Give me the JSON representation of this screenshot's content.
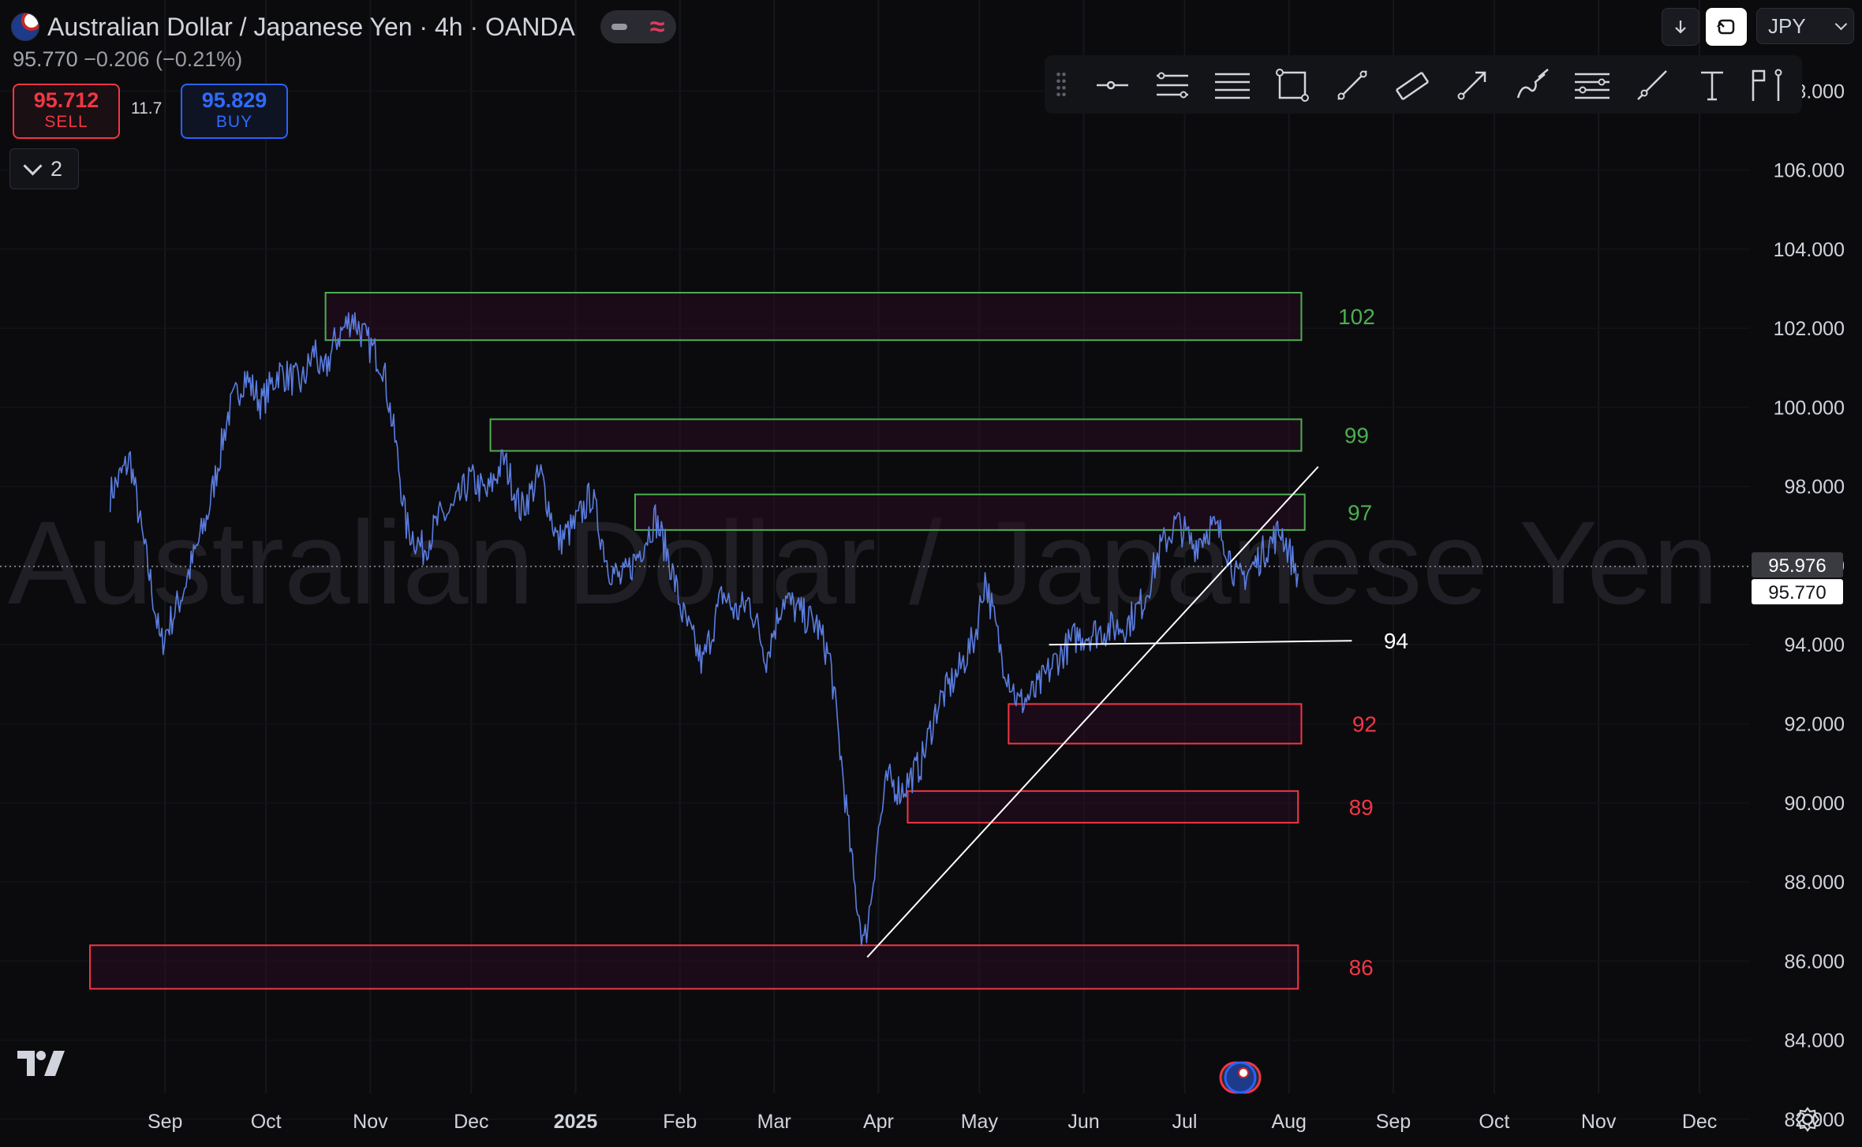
{
  "header": {
    "title": "Australian Dollar / Japanese Yen · 4h · OANDA",
    "last_price": "95.770",
    "change": "−0.206 (−0.21%)",
    "watermark": "Australian Dollar / Japanese Yen"
  },
  "trade": {
    "sell_price": "95.712",
    "sell_label": "SELL",
    "spread": "11.7",
    "buy_price": "95.829",
    "buy_label": "BUY"
  },
  "indicators_toggle": {
    "count": "2"
  },
  "top_right": {
    "currency": "JPY"
  },
  "toolbar_icons": [
    "drag-handle-icon",
    "horizontal-ray-icon",
    "parallel-lines-icon",
    "horizontal-lines-icon",
    "rectangle-icon",
    "trend-line-icon",
    "channel-icon",
    "arrow-icon",
    "brush-icon",
    "fib-retracement-icon",
    "ray-icon",
    "text-icon",
    "anchored-note-icon"
  ],
  "colors": {
    "background": "#0b0b0e",
    "price_line": "#5b7de0",
    "resistance_zone": "#4caf50",
    "support_zone": "#f23645",
    "current_price_label_bg": "#ffffff",
    "axis_text": "#d1d4dc"
  },
  "chart_data": {
    "type": "line",
    "instrument": "AUD/JPY",
    "timeframe": "4h",
    "x_axis_labels": [
      "Sep",
      "Oct",
      "Nov",
      "Dec",
      "2025",
      "Feb",
      "Mar",
      "Apr",
      "May",
      "Jun",
      "Jul",
      "Aug",
      "Sep",
      "Oct",
      "Nov",
      "Dec"
    ],
    "y_ticks": [
      "82.000",
      "84.000",
      "86.000",
      "88.000",
      "90.000",
      "92.000",
      "94.000",
      "96.000",
      "98.000",
      "100.000",
      "102.000",
      "104.000",
      "106.000",
      "108.000"
    ],
    "ylim": [
      81.3,
      110.3
    ],
    "grid": true,
    "price_labels": {
      "upper": "95.976",
      "current": "95.770"
    },
    "series": [
      {
        "x": [
          "2024-08-26",
          "2024-09-01",
          "2024-09-04",
          "2024-09-07",
          "2024-09-10",
          "2024-09-16",
          "2024-09-24",
          "2024-09-30",
          "2024-10-05",
          "2024-10-10",
          "2024-10-15",
          "2024-10-22",
          "2024-10-26",
          "2024-10-28",
          "2024-11-01",
          "2024-11-06",
          "2024-11-10",
          "2024-11-15",
          "2024-11-19",
          "2024-11-22",
          "2024-11-27",
          "2024-12-02",
          "2024-12-06",
          "2024-12-11",
          "2024-12-16",
          "2024-12-21",
          "2024-12-26",
          "2025-01-01",
          "2025-01-06",
          "2025-01-11",
          "2025-01-16",
          "2025-01-21",
          "2025-01-25",
          "2025-01-30",
          "2025-02-04",
          "2025-02-08",
          "2025-02-12",
          "2025-02-18",
          "2025-02-24",
          "2025-02-28",
          "2025-03-04",
          "2025-03-09",
          "2025-03-14",
          "2025-03-19",
          "2025-03-24",
          "2025-03-28",
          "2025-04-01",
          "2025-04-04",
          "2025-04-07",
          "2025-04-09",
          "2025-04-11",
          "2025-04-14",
          "2025-04-18",
          "2025-04-24",
          "2025-04-29",
          "2025-05-05",
          "2025-05-10",
          "2025-05-13",
          "2025-05-18",
          "2025-05-23",
          "2025-05-28",
          "2025-06-03",
          "2025-06-09",
          "2025-06-14",
          "2025-06-19",
          "2025-06-24",
          "2025-06-29",
          "2025-07-04",
          "2025-07-09",
          "2025-07-14",
          "2025-07-19",
          "2025-07-23",
          "2025-07-27",
          "2025-08-01",
          "2025-08-05",
          "2025-08-09",
          "2025-08-12",
          "2025-08-14"
        ],
        "y": [
          97.8,
          98.7,
          97.0,
          95.6,
          94.0,
          95.2,
          97.3,
          99.8,
          100.8,
          100.1,
          100.9,
          100.6,
          101.5,
          100.7,
          101.7,
          102.3,
          101.7,
          101.1,
          99.0,
          97.0,
          96.4,
          97.2,
          97.4,
          98.2,
          97.8,
          98.7,
          97.4,
          98.3,
          96.6,
          97.0,
          97.8,
          96.0,
          95.6,
          96.3,
          97.2,
          96.2,
          94.8,
          93.5,
          95.3,
          94.8,
          95.1,
          93.7,
          95.2,
          94.8,
          94.5,
          93.6,
          90.5,
          88.0,
          86.4,
          87.5,
          89.1,
          90.6,
          90.3,
          91.0,
          92.5,
          93.3,
          94.2,
          95.7,
          93.7,
          92.5,
          92.8,
          93.6,
          94.2,
          94.3,
          94.4,
          94.5,
          95.1,
          96.4,
          97.1,
          96.5,
          97.0,
          96.7,
          95.6,
          96.0,
          96.5,
          96.9,
          96.2,
          95.8
        ]
      }
    ],
    "zones": [
      {
        "label": "102",
        "low": 101.7,
        "high": 102.9,
        "start": "2024-10-29",
        "end": "2025-08-15",
        "kind": "resistance"
      },
      {
        "label": "99",
        "low": 98.9,
        "high": 99.7,
        "start": "2024-12-17",
        "end": "2025-08-15",
        "kind": "resistance"
      },
      {
        "label": "97",
        "low": 96.9,
        "high": 97.8,
        "start": "2025-01-29",
        "end": "2025-08-16",
        "kind": "resistance"
      },
      {
        "label": "92",
        "low": 91.5,
        "high": 92.5,
        "start": "2025-05-20",
        "end": "2025-08-15",
        "kind": "support"
      },
      {
        "label": "89",
        "low": 89.5,
        "high": 90.3,
        "start": "2025-04-20",
        "end": "2025-08-14",
        "kind": "support"
      },
      {
        "label": "86",
        "low": 85.3,
        "high": 86.4,
        "start": "2024-08-20",
        "end": "2025-08-14",
        "kind": "support"
      }
    ],
    "lines": [
      {
        "label": "",
        "from": [
          "2025-04-08",
          86.1
        ],
        "to": [
          "2025-08-20",
          98.5
        ]
      },
      {
        "label": "94",
        "from": [
          "2025-06-01",
          94.0
        ],
        "to": [
          "2025-08-30",
          94.1
        ]
      }
    ]
  }
}
